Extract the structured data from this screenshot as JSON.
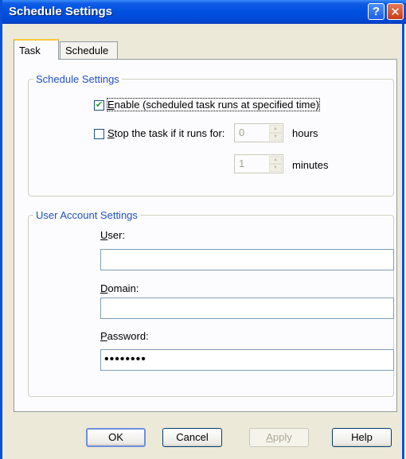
{
  "window": {
    "title": "Schedule Settings",
    "help_glyph": "?",
    "close_glyph": "✕"
  },
  "tabs": [
    {
      "label": "Task"
    },
    {
      "label": "Schedule"
    }
  ],
  "schedule_group": {
    "legend": "Schedule Settings",
    "enable": {
      "checked": true,
      "check_glyph": "✔",
      "label": "Enable (scheduled task runs at specified time)"
    },
    "stop": {
      "checked": false,
      "label": "Stop the task if it runs for:"
    },
    "hours": {
      "value": "0",
      "unit": "hours"
    },
    "minutes": {
      "value": "1",
      "unit": "minutes"
    }
  },
  "account_group": {
    "legend": "User Account Settings",
    "user": {
      "label": "User:",
      "value": ""
    },
    "domain": {
      "label": "Domain:",
      "value": ""
    },
    "password": {
      "label": "Password:",
      "value": "••••••••"
    }
  },
  "buttons": {
    "ok": "OK",
    "cancel": "Cancel",
    "apply": "Apply",
    "help": "Help"
  },
  "spinner": {
    "up": "▲",
    "down": "▼"
  }
}
